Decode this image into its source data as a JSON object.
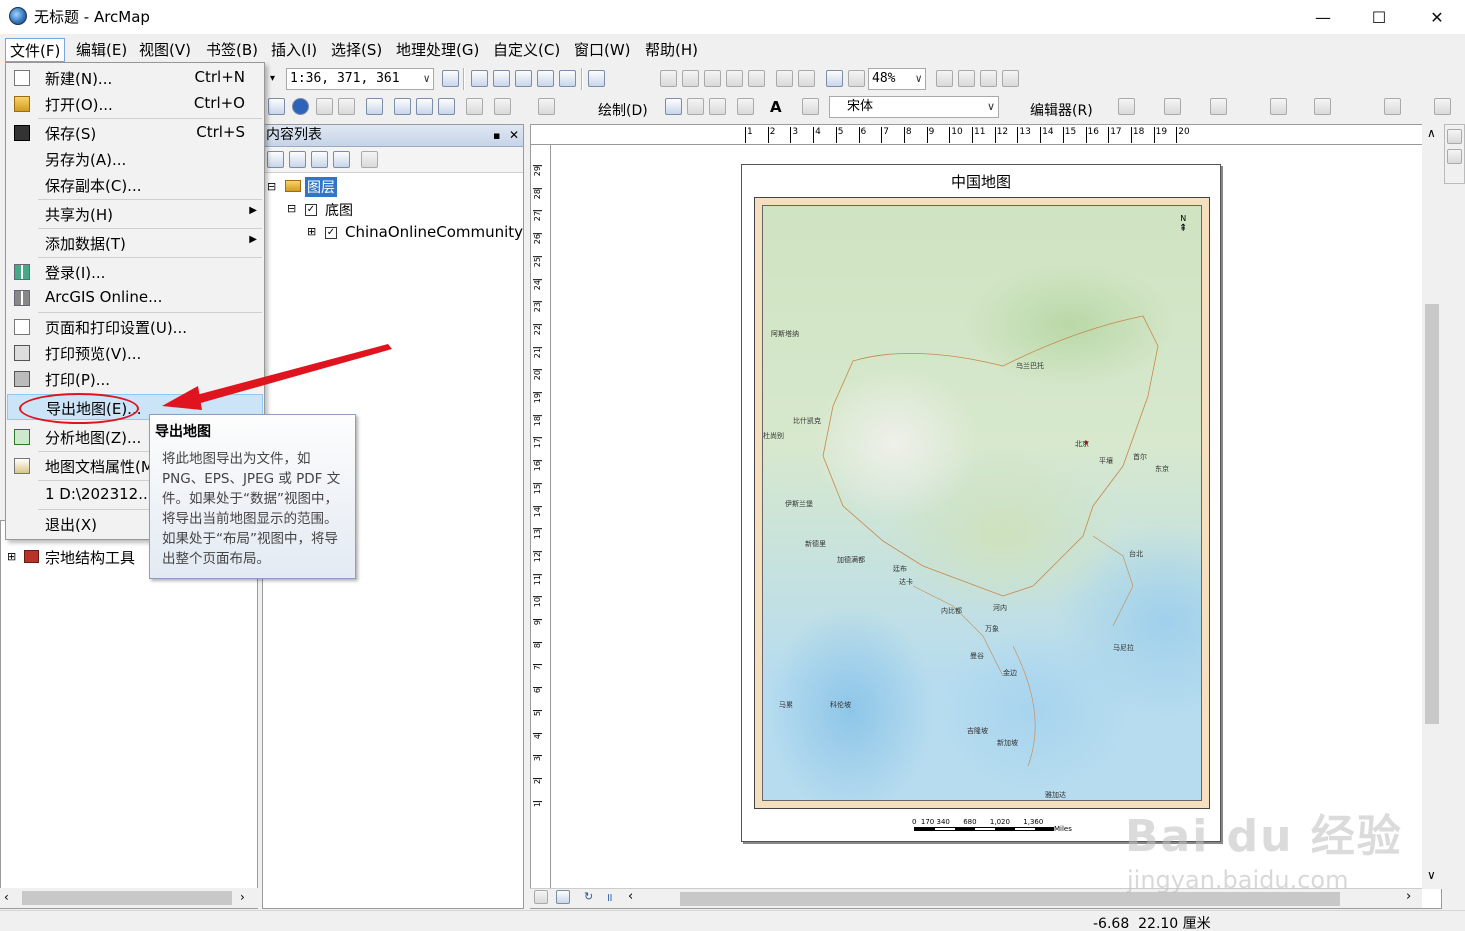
{
  "window": {
    "title": "无标题 - ArcMap",
    "minimize": "—",
    "maximize": "☐",
    "close": "✕"
  },
  "menubar": [
    "文件(F)",
    "编辑(E)",
    "视图(V)",
    "书签(B)",
    "插入(I)",
    "选择(S)",
    "地理处理(G)",
    "自定义(C)",
    "窗口(W)",
    "帮助(H)"
  ],
  "toolbar": {
    "scale": "1:36, 371, 361",
    "zoom": "48%",
    "draw_label": "绘制(D)",
    "font": "宋体",
    "editor_label": "编辑器(R)"
  },
  "file_menu": [
    {
      "label": "新建(N)...",
      "shortcut": "Ctrl+N",
      "icon": "new-doc-icon"
    },
    {
      "label": "打开(O)...",
      "shortcut": "Ctrl+O",
      "icon": "open-folder-icon"
    },
    {
      "label": "保存(S)",
      "shortcut": "Ctrl+S",
      "icon": "save-icon"
    },
    {
      "label": "另存为(A)...",
      "shortcut": ""
    },
    {
      "label": "保存副本(C)...",
      "shortcut": ""
    },
    {
      "label": "共享为(H)",
      "submenu": true
    },
    {
      "label": "添加数据(T)",
      "submenu": true
    },
    {
      "label": "登录(I)...",
      "icon": "login-icon"
    },
    {
      "label": "ArcGIS Online...",
      "icon": "grid-icon"
    },
    {
      "label": "页面和打印设置(U)...",
      "icon": "page-setup-icon"
    },
    {
      "label": "打印预览(V)...",
      "icon": "print-preview-icon"
    },
    {
      "label": "打印(P)...",
      "icon": "print-icon"
    },
    {
      "label": "导出地图(E)...",
      "highlighted": true
    },
    {
      "label": "分析地图(Z)...",
      "icon": "analyze-icon"
    },
    {
      "label": "地图文档属性(M",
      "icon": "properties-icon"
    },
    {
      "label": "1 D:\\202312...\\"
    },
    {
      "label": "退出(X)"
    }
  ],
  "tooltip": {
    "title": "导出地图",
    "body": "将此地图导出为文件，如PNG、EPS、JPEG 或 PDF 文件。如果处于“数据”视图中，将导出当前地图显示的范围。如果处于“布局”视图中，将导出整个页面布局。"
  },
  "toc": {
    "title": "内容列表",
    "pin": "ᵖ",
    "close": "✕",
    "root": "图层",
    "group": "底图",
    "layer": "ChinaOnlineCommunity"
  },
  "catalog": {
    "items": [
      "宗地结构工具"
    ]
  },
  "map": {
    "title": "中国地图",
    "scale_numbers": "0  170 340      680      1,020      1,360",
    "scale_unit": "Miles",
    "north": "N",
    "labels": [
      "北京",
      "乌兰巴托",
      "首尔",
      "平壤",
      "东京",
      "阿斯塔纳",
      "比什凯克",
      "杜尚别",
      "伊斯兰堡",
      "新德里",
      "加德满都",
      "廷布",
      "达卡",
      "内比都",
      "河内",
      "万象",
      "曼谷",
      "金边",
      "马尼拉",
      "吉隆坡",
      "新加坡",
      "雅加达",
      "马累",
      "科伦坡",
      "台北"
    ]
  },
  "status": {
    "coords": "-6.68  22.10 厘米"
  },
  "ruler_h": [
    "1",
    "2",
    "3",
    "4",
    "5",
    "6",
    "7",
    "8",
    "9",
    "10",
    "11",
    "12",
    "13",
    "14",
    "15",
    "16",
    "17",
    "18",
    "19",
    "20"
  ],
  "ruler_v": [
    "29",
    "28",
    "27",
    "26",
    "25",
    "24",
    "23",
    "22",
    "21",
    "20",
    "19",
    "18",
    "17",
    "16",
    "15",
    "14",
    "13",
    "12",
    "11",
    "10",
    "9",
    "8",
    "7",
    "6",
    "5",
    "4",
    "3",
    "2",
    "1"
  ],
  "watermark": {
    "brand": "Bai du 经验",
    "url": "jingyan.baidu.com"
  }
}
